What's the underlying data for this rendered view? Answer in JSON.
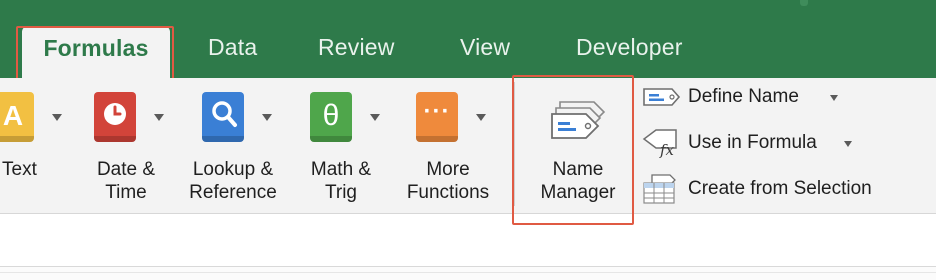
{
  "tabs": [
    {
      "label": "Formulas",
      "active": true
    },
    {
      "label": "Data"
    },
    {
      "label": "Review"
    },
    {
      "label": "View"
    },
    {
      "label": "Developer"
    }
  ],
  "ribbon": {
    "buttons": [
      {
        "label_line1": "Text",
        "label_line2": "",
        "icon": "text-book-icon",
        "color": "#f2c042",
        "glyph": "A"
      },
      {
        "label_line1": "Date &",
        "label_line2": "Time",
        "icon": "clock-book-icon",
        "color": "#d2443a",
        "glyph": "⏱"
      },
      {
        "label_line1": "Lookup &",
        "label_line2": "Reference",
        "icon": "magnifier-book-icon",
        "color": "#3a7fd5",
        "glyph": "🔍"
      },
      {
        "label_line1": "Math &",
        "label_line2": "Trig",
        "icon": "theta-book-icon",
        "color": "#4fa64b",
        "glyph": "θ"
      },
      {
        "label_line1": "More",
        "label_line2": "Functions",
        "icon": "dots-book-icon",
        "color": "#ef8a3c",
        "glyph": "···"
      },
      {
        "label_line1": "Name",
        "label_line2": "Manager",
        "icon": "name-tags-icon"
      }
    ],
    "defined_names": [
      {
        "label": "Define Name",
        "icon": "define-name-tag-icon",
        "has_dropdown": true
      },
      {
        "label": "Use in Formula",
        "icon": "use-in-formula-fx-icon",
        "has_dropdown": true
      },
      {
        "label": "Create from Selection",
        "icon": "create-from-selection-grid-icon",
        "has_dropdown": false
      }
    ]
  },
  "colors": {
    "tab_bar": "#2e7a4a",
    "ribbon_bg": "#f3f3f3",
    "highlight_outline": "#e05a43"
  }
}
